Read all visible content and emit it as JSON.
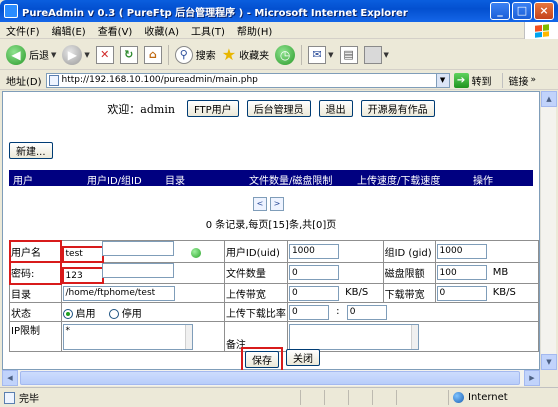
{
  "window": {
    "title": "PureAdmin v 0.3 ( PureFtp 后台管理程序 ) - Microsoft Internet Explorer",
    "minimize": "_",
    "maximize": "□",
    "close": "×"
  },
  "menu": [
    "文件(F)",
    "编辑(E)",
    "查看(V)",
    "收藏(A)",
    "工具(T)",
    "帮助(H)"
  ],
  "toolbar": {
    "back": "后退",
    "search": "搜索",
    "favorites": "收藏夹"
  },
  "address": {
    "label": "地址(D)",
    "url": "http://192.168.10.100/pureadmin/main.php",
    "go": "转到",
    "links": "链接"
  },
  "nav": {
    "welcome": "欢迎：admin",
    "ftp_users": "FTP用户",
    "admins": "后台管理员",
    "logout": "退出",
    "open_source": "开源易有作品"
  },
  "new_button": "新建...",
  "grid": {
    "columns": [
      "用户",
      "用户ID/组ID",
      "目录",
      "文件数量/磁盘限制",
      "上传速度/下载速度",
      "操作"
    ]
  },
  "pager": {
    "prev": "<",
    "next": ">",
    "summary": "0 条记录,每页[15]条,共[0]页"
  },
  "form": {
    "username_label": "用户名",
    "username_value": "test",
    "password_label": "密码:",
    "password_value": "123",
    "directory_label": "目录",
    "directory_value": "/home/ftphome/test",
    "status_label": "状态",
    "enabled_label": "启用",
    "disabled_label": "停用",
    "ip_limit_label": "IP限制",
    "ip_limit_value": "*",
    "uid_label": "用户ID(uid)",
    "uid_value": "1000",
    "gid_label": "组ID (gid)",
    "gid_value": "1000",
    "file_count_label": "文件数量",
    "file_count_value": "0",
    "disk_limit_label": "磁盘限额",
    "disk_limit_value": "100",
    "disk_unit": "MB",
    "upload_bw_label": "上传带宽",
    "upload_bw_value": "0",
    "upload_unit": "KB/S",
    "download_bw_label": "下载带宽",
    "download_bw_value": "0",
    "download_unit": "KB/S",
    "ratio_label": "上传下载比率",
    "ratio_up": "0",
    "ratio_sep": ":",
    "ratio_down": "0",
    "remark_label": "备注",
    "save": "保存",
    "close": "关闭"
  },
  "status": {
    "text": "完毕",
    "zone": "Internet"
  },
  "colors": {
    "grid_header": "#000080",
    "highlight": "#d81b1b"
  }
}
